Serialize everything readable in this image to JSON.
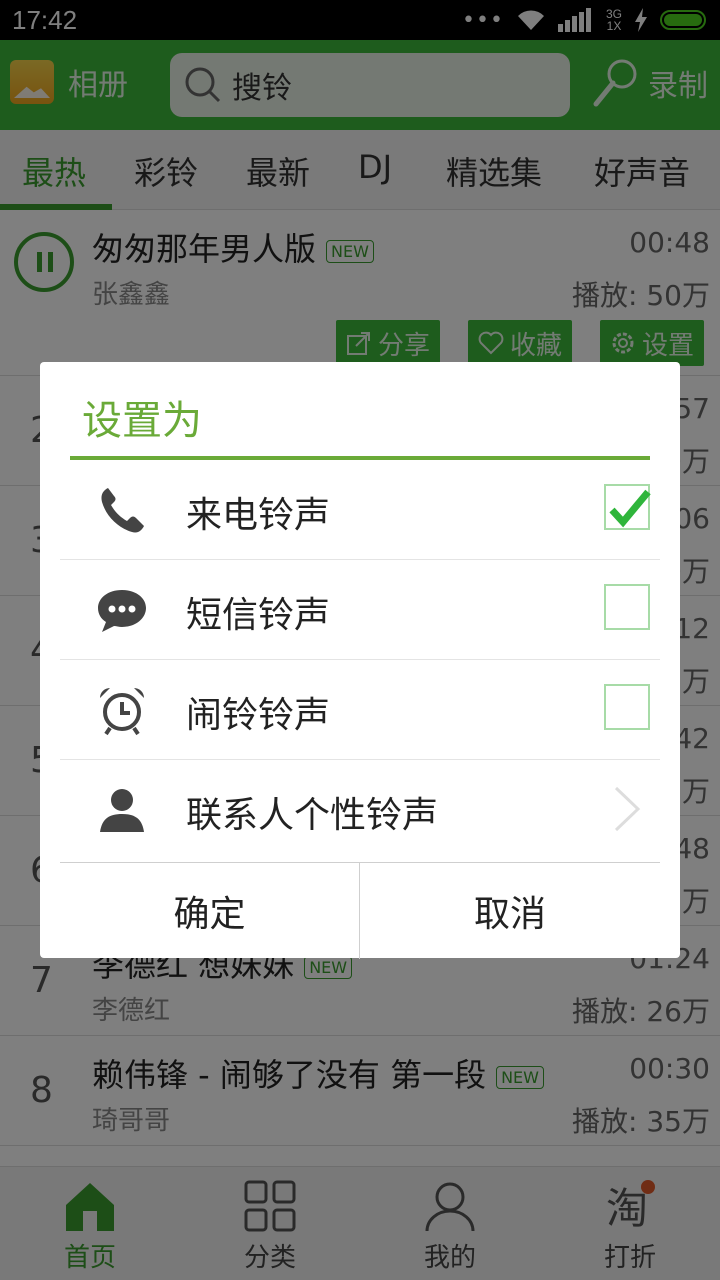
{
  "status": {
    "time": "17:42",
    "network_top": "3G",
    "network_bottom": "1X"
  },
  "header": {
    "album_label": "相册",
    "search_placeholder": "搜铃",
    "record_label": "录制"
  },
  "tabs": [
    "最热",
    "彩铃",
    "最新",
    "DJ",
    "精选集",
    "好声音"
  ],
  "songs": [
    {
      "num": "",
      "title": "匆匆那年男人版",
      "new": true,
      "artist": "张鑫鑫",
      "duration": "00:48",
      "plays": "播放: 50万"
    },
    {
      "num": "2",
      "title": "",
      "new": false,
      "artist": "",
      "duration": "57",
      "plays": "0万"
    },
    {
      "num": "3",
      "title": "",
      "new": false,
      "artist": "",
      "duration": "06",
      "plays": "0万"
    },
    {
      "num": "4",
      "title": "",
      "new": false,
      "artist": "",
      "duration": "12",
      "plays": "7万"
    },
    {
      "num": "5",
      "title": "",
      "new": false,
      "artist": "",
      "duration": "42",
      "plays": "5万"
    },
    {
      "num": "6",
      "title": "",
      "new": false,
      "artist": "",
      "duration": "48",
      "plays": "7万"
    },
    {
      "num": "7",
      "title": "李德红 想妹妹",
      "new": true,
      "artist": "李德红",
      "duration": "01:24",
      "plays": "播放: 26万"
    },
    {
      "num": "8",
      "title": "赖伟锋 - 闹够了没有 第一段",
      "new": true,
      "artist": "琦哥哥",
      "duration": "00:30",
      "plays": "播放: 35万"
    }
  ],
  "new_tag": "NEW",
  "row_actions": {
    "share": "分享",
    "favorite": "收藏",
    "settings": "设置"
  },
  "dialog": {
    "title": "设置为",
    "options": [
      {
        "label": "来电铃声",
        "checked": true
      },
      {
        "label": "短信铃声",
        "checked": false
      },
      {
        "label": "闹铃铃声",
        "checked": false
      },
      {
        "label": "联系人个性铃声"
      }
    ],
    "confirm": "确定",
    "cancel": "取消"
  },
  "bottom_nav": [
    "首页",
    "分类",
    "我的",
    "打折"
  ],
  "colors": {
    "brand_green": "#3cb93a",
    "accent_green": "#3a9d2f",
    "dialog_green": "#6aaa38"
  }
}
